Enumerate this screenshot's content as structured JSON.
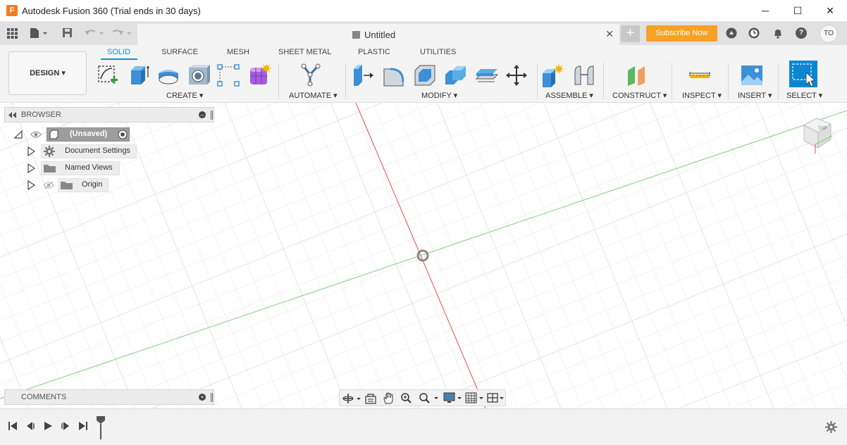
{
  "window": {
    "app_icon": "F",
    "title": "Autodesk Fusion 360 (Trial ends in 30 days)",
    "minimize": "─",
    "maximize": "☐",
    "close": "✕"
  },
  "quickbar": {
    "doc_title": "Untitled",
    "close_tab": "✕",
    "new_tab": "+",
    "subscribe": "Subscribe Now",
    "user_initials": "TO",
    "help": "?"
  },
  "ribbon": {
    "workspace": "DESIGN ▾",
    "tabs": [
      "SOLID",
      "SURFACE",
      "MESH",
      "SHEET METAL",
      "PLASTIC",
      "UTILITIES"
    ],
    "active_tab": "SOLID",
    "groups": [
      "CREATE ▾",
      "AUTOMATE ▾",
      "MODIFY ▾",
      "ASSEMBLE ▾",
      "CONSTRUCT ▾",
      "INSPECT ▾",
      "INSERT ▾",
      "SELECT ▾"
    ],
    "accent": "#0696d7"
  },
  "browser": {
    "title": "BROWSER",
    "root": "(Unsaved)",
    "items": [
      "Document Settings",
      "Named Views",
      "Origin"
    ]
  },
  "comments": {
    "title": "COMMENTS"
  },
  "viewcube": {
    "face": "TOP"
  },
  "colors": {
    "subscribe": "#f6a225",
    "x_axis": "#e44c4c",
    "y_axis": "#7fd07f"
  }
}
